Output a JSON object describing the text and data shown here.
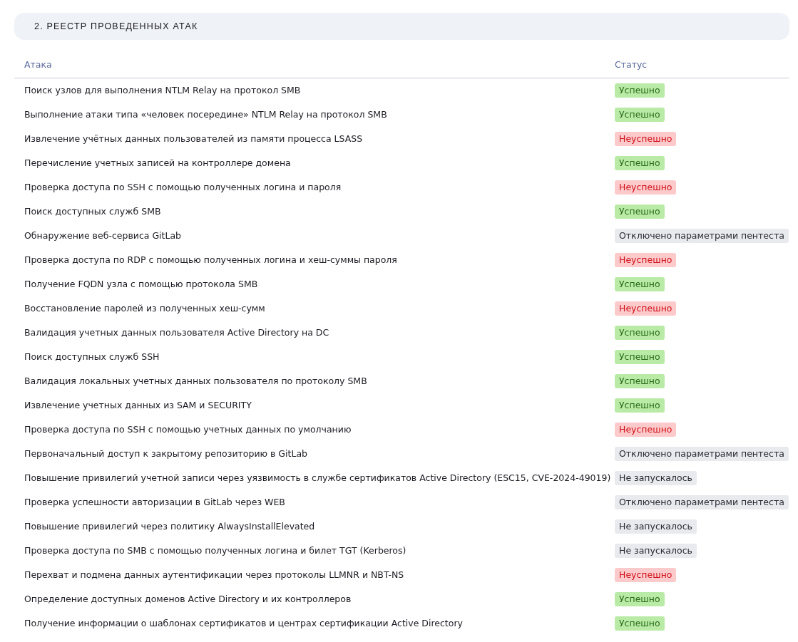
{
  "section": {
    "title": "2. РЕЕСТР ПРОВЕДЕННЫХ АТАК"
  },
  "table": {
    "columns": [
      "Атака",
      "Статус"
    ],
    "rows": [
      {
        "attack": "Поиск узлов для выполнения NTLM Relay на протокол SMB",
        "status": "Успешно",
        "kind": "success"
      },
      {
        "attack": "Выполнение атаки типа «человек посередине» NTLM Relay на протокол SMB",
        "status": "Успешно",
        "kind": "success"
      },
      {
        "attack": "Извлечение учётных данных пользователей из памяти процесса LSASS",
        "status": "Неуспешно",
        "kind": "fail"
      },
      {
        "attack": "Перечисление учетных записей на контроллере домена",
        "status": "Успешно",
        "kind": "success"
      },
      {
        "attack": "Проверка доступа по SSH с помощью полученных логина и пароля",
        "status": "Неуспешно",
        "kind": "fail"
      },
      {
        "attack": "Поиск доступных служб SMB",
        "status": "Успешно",
        "kind": "success"
      },
      {
        "attack": "Обнаружение веб-сервиса GitLab",
        "status": "Отключено параметрами пентеста",
        "kind": "neutral"
      },
      {
        "attack": "Проверка доступа по RDP с помощью полученных логина и хеш-суммы пароля",
        "status": "Неуспешно",
        "kind": "fail"
      },
      {
        "attack": "Получение FQDN узла с помощью протокола SMB",
        "status": "Успешно",
        "kind": "success"
      },
      {
        "attack": "Восстановление паролей из полученных хеш-сумм",
        "status": "Неуспешно",
        "kind": "fail"
      },
      {
        "attack": "Валидация учетных данных пользователя Active Directory на DC",
        "status": "Успешно",
        "kind": "success"
      },
      {
        "attack": "Поиск доступных служб SSH",
        "status": "Успешно",
        "kind": "success"
      },
      {
        "attack": "Валидация локальных учетных данных пользователя по протоколу SMB",
        "status": "Успешно",
        "kind": "success"
      },
      {
        "attack": "Извлечение учетных данных из SAM и SECURITY",
        "status": "Успешно",
        "kind": "success"
      },
      {
        "attack": "Проверка доступа по SSH с помощью учетных данных по умолчанию",
        "status": "Неуспешно",
        "kind": "fail"
      },
      {
        "attack": "Первоначальный доступ к закрытому репозиторию в GitLab",
        "status": "Отключено параметрами пентеста",
        "kind": "neutral"
      },
      {
        "attack": "Повышение привилегий учетной записи через уязвимость в службе сертификатов Active Directory (ESC15, CVE-2024-49019)",
        "status": "Не запускалось",
        "kind": "neutral"
      },
      {
        "attack": "Проверка успешности авторизации в GitLab через WEB",
        "status": "Отключено параметрами пентеста",
        "kind": "neutral"
      },
      {
        "attack": "Повышение привилегий через политику AlwaysInstallElevated",
        "status": "Не запускалось",
        "kind": "neutral"
      },
      {
        "attack": "Проверка доступа по SMB с помощью полученных логина и билет TGT (Kerberos)",
        "status": "Не запускалось",
        "kind": "neutral"
      },
      {
        "attack": "Перехват и подмена данных аутентификации через протоколы LLMNR и NBT-NS",
        "status": "Неуспешно",
        "kind": "fail"
      },
      {
        "attack": "Определение доступных доменов Active Directory и их контроллеров",
        "status": "Успешно",
        "kind": "success"
      },
      {
        "attack": "Получение информации о шаблонах сертификатов и центрах сертификации Active Directory",
        "status": "Успешно",
        "kind": "success"
      }
    ]
  }
}
